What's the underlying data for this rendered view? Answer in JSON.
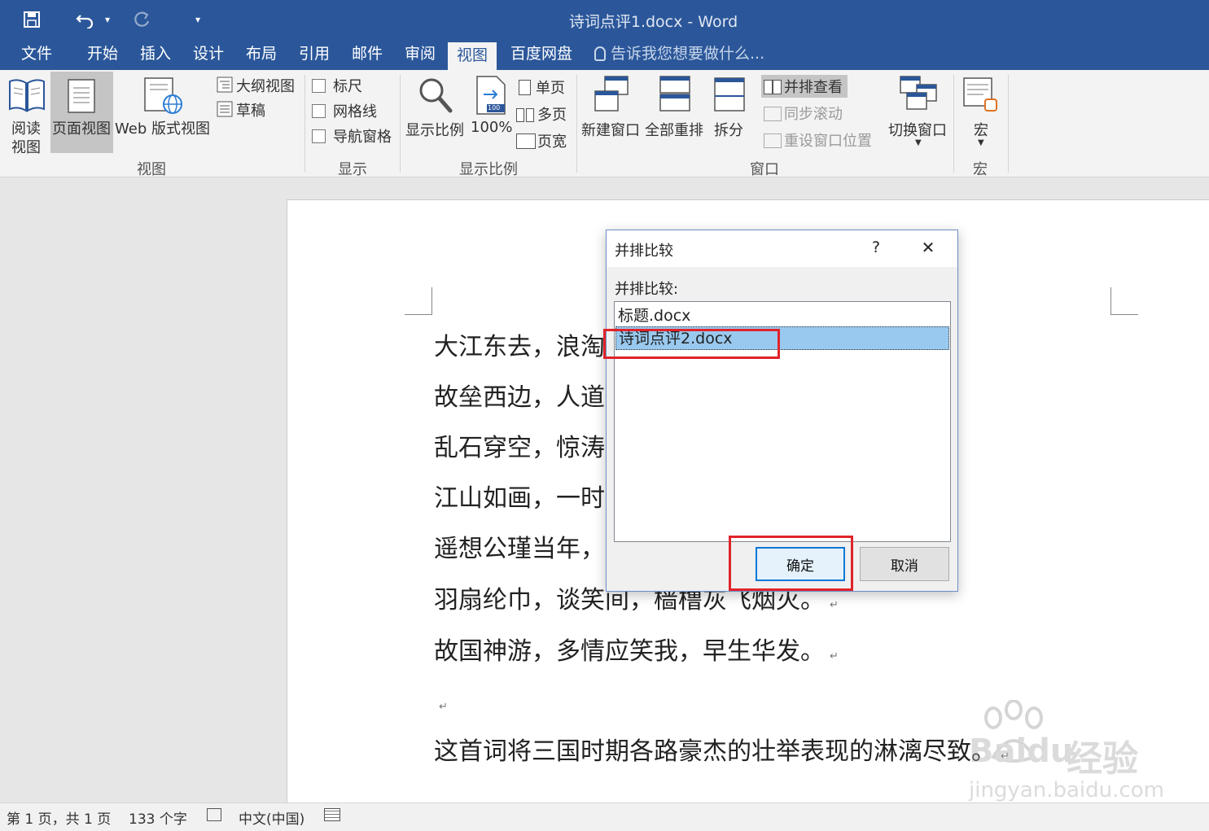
{
  "window": {
    "title": "诗词点评1.docx - Word"
  },
  "qat": {
    "save": "save-icon",
    "undo": "undo-icon",
    "dropdown": "▾",
    "redo": "redo-icon",
    "customize": "▾"
  },
  "tabs": [
    "文件",
    "开始",
    "插入",
    "设计",
    "布局",
    "引用",
    "邮件",
    "审阅",
    "视图",
    "百度网盘"
  ],
  "tell_me": "告诉我您想要做什么...",
  "ribbon": {
    "views": {
      "read_line1": "阅读",
      "read_line2": "视图",
      "print_layout": "页面视图",
      "web_layout": "Web 版式视图",
      "outline": "大纲视图",
      "draft": "草稿",
      "label": "视图"
    },
    "show": {
      "ruler": "标尺",
      "gridlines": "网格线",
      "nav_pane": "导航窗格",
      "label": "显示"
    },
    "zoom": {
      "zoom": "显示比例",
      "pct100": "100%",
      "one_page": "单页",
      "multi_page": "多页",
      "page_width": "页宽",
      "label": "显示比例",
      "icon_badge": "100"
    },
    "window": {
      "new_window": "新建窗口",
      "arrange_all": "全部重排",
      "split": "拆分",
      "side_by_side": "并排查看",
      "sync_scroll": "同步滚动",
      "reset_pos": "重设窗口位置",
      "switch": "切换窗口",
      "label": "窗口"
    },
    "macros": {
      "macro": "宏",
      "label": "宏"
    }
  },
  "document": {
    "lines": [
      "大江东去，浪淘",
      "故垒西边，人道",
      "乱石穿空，惊涛",
      "江山如画，一时",
      "遥想公瑾当年，",
      "羽扇纶巾，谈笑间，樯橹灰飞烟灭。",
      "故国神游，多情应笑我，早生华发。",
      "",
      "这首词将三国时期各路豪杰的壮举表现的淋漓尽致。"
    ],
    "para_mark": "↵"
  },
  "dialog": {
    "title": "并排比较",
    "help": "?",
    "close": "✕",
    "label": "并排比较:",
    "items": [
      "标题.docx",
      "诗词点评2.docx"
    ],
    "selected_index": 1,
    "ok": "确定",
    "cancel": "取消"
  },
  "status": {
    "page": "第 1 页，共 1 页",
    "words": "133 个字",
    "language": "中文(中国)"
  },
  "watermark": {
    "brand": "Bai",
    "brand2": "du",
    "product": "经验",
    "url": "jingyan.baidu.com"
  },
  "colors": {
    "title_blue": "#2b579a",
    "highlight": "#e0232a",
    "selection": "#99c9ef"
  }
}
